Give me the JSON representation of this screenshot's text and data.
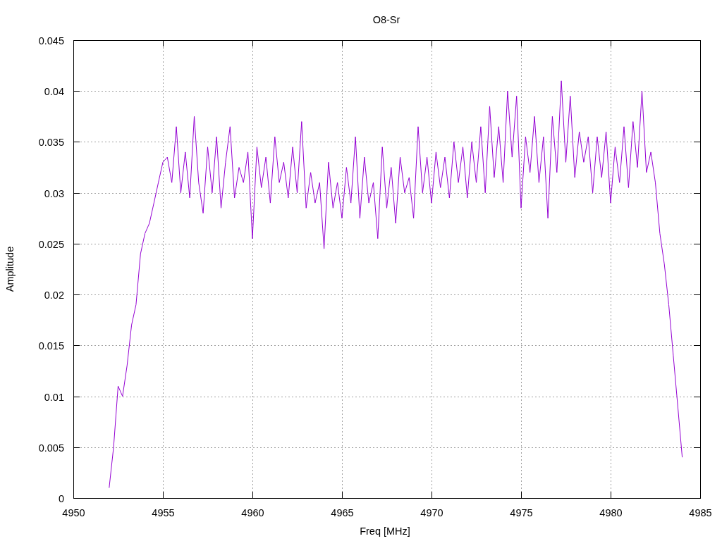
{
  "chart_data": {
    "type": "line",
    "title": "O8-Sr",
    "xlabel": "Freq [MHz]",
    "ylabel": "Amplitude",
    "grid": true,
    "xlim": [
      4950,
      4985
    ],
    "ylim": [
      0,
      0.045
    ],
    "xticks": [
      4950,
      4955,
      4960,
      4965,
      4970,
      4975,
      4980,
      4985
    ],
    "yticks": [
      {
        "value": 0,
        "label": "0"
      },
      {
        "value": 0.005,
        "label": "0.005"
      },
      {
        "value": 0.01,
        "label": "0.01"
      },
      {
        "value": 0.015,
        "label": "0.015"
      },
      {
        "value": 0.02,
        "label": "0.02"
      },
      {
        "value": 0.025,
        "label": "0.025"
      },
      {
        "value": 0.03,
        "label": "0.03"
      },
      {
        "value": 0.035,
        "label": "0.035"
      },
      {
        "value": 0.04,
        "label": "0.04"
      },
      {
        "value": 0.045,
        "label": "0.045"
      }
    ],
    "x": [
      4952,
      4952.25,
      4952.5,
      4952.75,
      4953,
      4953.25,
      4953.5,
      4953.75,
      4954,
      4954.25,
      4954.5,
      4954.75,
      4955,
      4955.25,
      4955.5,
      4955.75,
      4956,
      4956.25,
      4956.5,
      4956.75,
      4957,
      4957.25,
      4957.5,
      4957.75,
      4958,
      4958.25,
      4958.5,
      4958.75,
      4959,
      4959.25,
      4959.5,
      4959.75,
      4960,
      4960.25,
      4960.5,
      4960.75,
      4961,
      4961.25,
      4961.5,
      4961.75,
      4962,
      4962.25,
      4962.5,
      4962.75,
      4963,
      4963.25,
      4963.5,
      4963.75,
      4964,
      4964.25,
      4964.5,
      4964.75,
      4965,
      4965.25,
      4965.5,
      4965.75,
      4966,
      4966.25,
      4966.5,
      4966.75,
      4967,
      4967.25,
      4967.5,
      4967.75,
      4968,
      4968.25,
      4968.5,
      4968.75,
      4969,
      4969.25,
      4969.5,
      4969.75,
      4970,
      4970.25,
      4970.5,
      4970.75,
      4971,
      4971.25,
      4971.5,
      4971.75,
      4972,
      4972.25,
      4972.5,
      4972.75,
      4973,
      4973.25,
      4973.5,
      4973.75,
      4974,
      4974.25,
      4974.5,
      4974.75,
      4975,
      4975.25,
      4975.5,
      4975.75,
      4976,
      4976.25,
      4976.5,
      4976.75,
      4977,
      4977.25,
      4977.5,
      4977.75,
      4978,
      4978.25,
      4978.5,
      4978.75,
      4979,
      4979.25,
      4979.5,
      4979.75,
      4980,
      4980.25,
      4980.5,
      4980.75,
      4981,
      4981.25,
      4981.5,
      4981.75,
      4982,
      4982.25,
      4982.5,
      4982.75,
      4983,
      4983.25,
      4983.5,
      4983.75,
      4984
    ],
    "series": [
      {
        "color": "#9400d3",
        "values": [
          0.001,
          0.005,
          0.011,
          0.01,
          0.013,
          0.017,
          0.019,
          0.024,
          0.026,
          0.027,
          0.029,
          0.031,
          0.033,
          0.0335,
          0.031,
          0.0365,
          0.03,
          0.034,
          0.0295,
          0.0375,
          0.031,
          0.028,
          0.0345,
          0.03,
          0.0355,
          0.0285,
          0.033,
          0.0365,
          0.0295,
          0.0325,
          0.031,
          0.034,
          0.0255,
          0.0345,
          0.0305,
          0.0335,
          0.029,
          0.0355,
          0.031,
          0.033,
          0.0295,
          0.0345,
          0.03,
          0.037,
          0.0285,
          0.032,
          0.029,
          0.031,
          0.0245,
          0.033,
          0.0285,
          0.031,
          0.0275,
          0.0325,
          0.029,
          0.0355,
          0.0275,
          0.0335,
          0.029,
          0.031,
          0.0255,
          0.0345,
          0.0285,
          0.0325,
          0.027,
          0.0335,
          0.03,
          0.0315,
          0.0275,
          0.0365,
          0.03,
          0.0335,
          0.029,
          0.034,
          0.0305,
          0.0335,
          0.0295,
          0.035,
          0.031,
          0.0345,
          0.0295,
          0.035,
          0.031,
          0.0365,
          0.03,
          0.0385,
          0.0315,
          0.0365,
          0.031,
          0.04,
          0.0335,
          0.0395,
          0.0285,
          0.0355,
          0.032,
          0.0375,
          0.031,
          0.0355,
          0.0275,
          0.0375,
          0.032,
          0.041,
          0.033,
          0.0395,
          0.0315,
          0.036,
          0.033,
          0.0355,
          0.03,
          0.0355,
          0.0315,
          0.036,
          0.029,
          0.0345,
          0.031,
          0.0365,
          0.0305,
          0.037,
          0.0325,
          0.04,
          0.032,
          0.034,
          0.031,
          0.026,
          0.023,
          0.019,
          0.014,
          0.009,
          0.004
        ]
      }
    ]
  }
}
